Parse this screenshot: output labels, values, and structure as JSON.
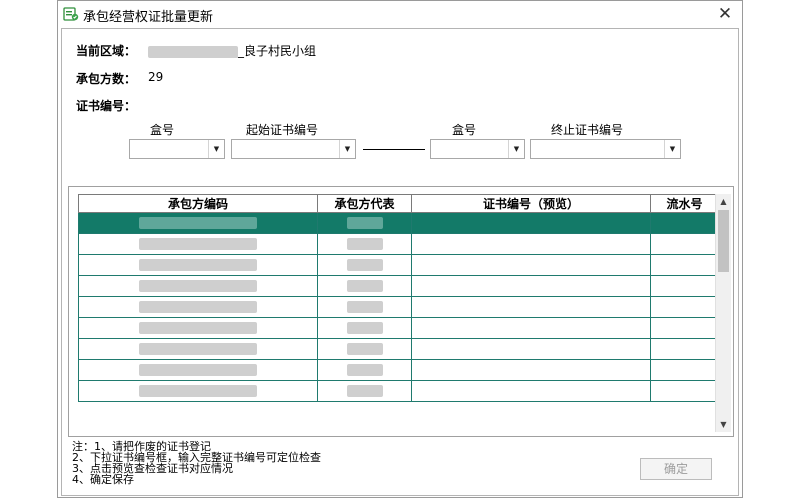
{
  "window": {
    "title": "承包经营权证批量更新",
    "close_glyph": "✕"
  },
  "info": {
    "area_label": "当前区域：",
    "area_value": "_良子村民小组",
    "count_label": "承包方数：",
    "count_value": "29",
    "cert_label": "证书编号："
  },
  "selectors": {
    "box1_label": "盒号",
    "start_label": "起始证书编号",
    "box2_label": "盒号",
    "end_label": "终止证书编号",
    "dropdown_glyph": "▼"
  },
  "grid": {
    "columns": [
      "承包方编码",
      "承包方代表",
      "证书编号（预览）",
      "流水号"
    ],
    "row_count": 9,
    "selected_row": 0,
    "selected_color": "#137a68",
    "line_color": "#1f7a6e"
  },
  "notes": [
    "注：1、请把作废的证书登记",
    "2、下拉证书编号框，输入完整证书编号可定位检查",
    "3、点击预览查检查证书对应情况",
    "4、确定保存"
  ],
  "buttons": {
    "ok_label": "确定"
  },
  "icons": {
    "app": "certificate-app-icon",
    "close": "close-icon",
    "dropdown": "chevron-down-icon",
    "scroll_up": "scroll-up-arrow-icon",
    "scroll_down": "scroll-down-arrow-icon"
  }
}
